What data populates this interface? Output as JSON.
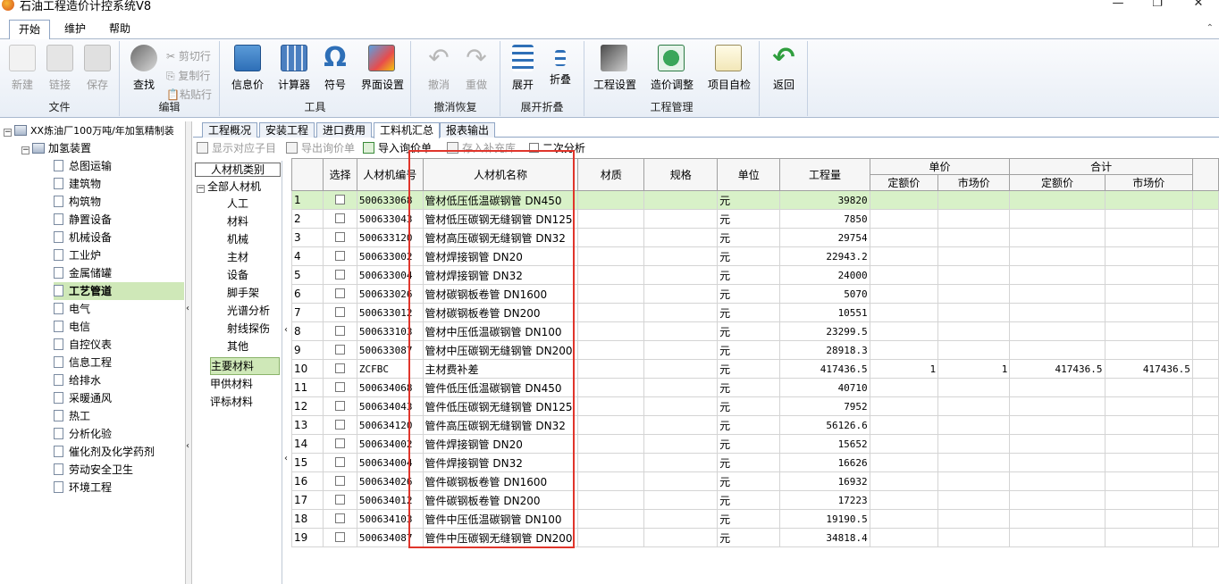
{
  "app": {
    "title": "石油工程造价计控系统V8"
  },
  "menu": {
    "tabs": [
      "开始",
      "维护",
      "帮助"
    ]
  },
  "ribbon": {
    "groups": {
      "file": {
        "title": "文件",
        "new": "新建",
        "link": "链接",
        "save": "保存"
      },
      "edit": {
        "title": "编辑",
        "find": "查找",
        "cut": "剪切行",
        "copy": "复制行",
        "paste": "粘贴行"
      },
      "tools": {
        "title": "工具",
        "info_price": "信息价",
        "calculator": "计算器",
        "symbol": "符号",
        "ui_settings": "界面设置"
      },
      "undo": {
        "title": "撤消恢复",
        "undo": "撤消",
        "redo": "重做"
      },
      "expand": {
        "title": "展开折叠",
        "expand": "展开",
        "collapse": "折叠"
      },
      "project": {
        "title": "工程管理",
        "project_settings": "工程设置",
        "price_adjust": "造价调整",
        "self_check": "项目自检"
      },
      "back": {
        "label": "返回"
      }
    }
  },
  "tree": {
    "root": "XX炼油厂100万吨/年加氢精制装",
    "unit": "加氢装置",
    "items": [
      "总图运输",
      "建筑物",
      "构筑物",
      "静置设备",
      "机械设备",
      "工业炉",
      "金属储罐",
      "工艺管道",
      "电气",
      "电信",
      "自控仪表",
      "信息工程",
      "给排水",
      "采暖通风",
      "热工",
      "分析化验",
      "催化剂及化学药剂",
      "劳动安全卫生",
      "环境工程"
    ],
    "selected": "工艺管道"
  },
  "page_tabs": [
    "工程概况",
    "安装工程",
    "进口费用",
    "工料机汇总",
    "报表输出"
  ],
  "active_tab": "工料机汇总",
  "toolbar": {
    "show_sub": "显示对应子目",
    "export_price": "导出询价单",
    "import_price": "导入询价单",
    "save_lib": "存入补充库",
    "secondary": "二次分析"
  },
  "category": {
    "header": "人材机类别",
    "all": "全部人材机",
    "children": [
      "人工",
      "材料",
      "机械",
      "主材",
      "设备",
      "脚手架",
      "光谱分析",
      "射线探伤",
      "其他"
    ],
    "others": [
      "主要材料",
      "甲供材料",
      "评标材料"
    ],
    "selected": "主要材料"
  },
  "grid": {
    "headers": {
      "select": "选择",
      "code": "人材机编号",
      "name": "人材机名称",
      "material": "材质",
      "spec": "规格",
      "unit": "单位",
      "qty": "工程量",
      "unit_price": "单价",
      "quota_price": "定额价",
      "market_price": "市场价",
      "total": "合计",
      "total_quota": "定额价",
      "total_market": "市场价"
    },
    "rows": [
      {
        "no": "1",
        "code": "500633068",
        "name": "管材低压低温碳钢管 DN450",
        "unit": "元",
        "qty": "39820",
        "qp": "",
        "mp": "",
        "tq": "",
        "tm": ""
      },
      {
        "no": "2",
        "code": "500633043",
        "name": "管材低压碳钢无缝钢管 DN125",
        "unit": "元",
        "qty": "7850",
        "qp": "",
        "mp": "",
        "tq": "",
        "tm": ""
      },
      {
        "no": "3",
        "code": "500633120",
        "name": "管材高压碳钢无缝钢管 DN32",
        "unit": "元",
        "qty": "29754",
        "qp": "",
        "mp": "",
        "tq": "",
        "tm": ""
      },
      {
        "no": "4",
        "code": "500633002",
        "name": "管材焊接钢管 DN20",
        "unit": "元",
        "qty": "22943.2",
        "qp": "",
        "mp": "",
        "tq": "",
        "tm": ""
      },
      {
        "no": "5",
        "code": "500633004",
        "name": "管材焊接钢管 DN32",
        "unit": "元",
        "qty": "24000",
        "qp": "",
        "mp": "",
        "tq": "",
        "tm": ""
      },
      {
        "no": "6",
        "code": "500633026",
        "name": "管材碳钢板卷管 DN1600",
        "unit": "元",
        "qty": "5070",
        "qp": "",
        "mp": "",
        "tq": "",
        "tm": ""
      },
      {
        "no": "7",
        "code": "500633012",
        "name": "管材碳钢板卷管 DN200",
        "unit": "元",
        "qty": "10551",
        "qp": "",
        "mp": "",
        "tq": "",
        "tm": ""
      },
      {
        "no": "8",
        "code": "500633103",
        "name": "管材中压低温碳钢管 DN100",
        "unit": "元",
        "qty": "23299.5",
        "qp": "",
        "mp": "",
        "tq": "",
        "tm": ""
      },
      {
        "no": "9",
        "code": "500633087",
        "name": "管材中压碳钢无缝钢管 DN200",
        "unit": "元",
        "qty": "28918.3",
        "qp": "",
        "mp": "",
        "tq": "",
        "tm": ""
      },
      {
        "no": "10",
        "code": "ZCFBC",
        "name": "主材费补差",
        "unit": "元",
        "qty": "417436.5",
        "qp": "1",
        "mp": "1",
        "tq": "417436.5",
        "tm": "417436.5"
      },
      {
        "no": "11",
        "code": "500634068",
        "name": "管件低压低温碳钢管 DN450",
        "unit": "元",
        "qty": "40710",
        "qp": "",
        "mp": "",
        "tq": "",
        "tm": ""
      },
      {
        "no": "12",
        "code": "500634043",
        "name": "管件低压碳钢无缝钢管 DN125",
        "unit": "元",
        "qty": "7952",
        "qp": "",
        "mp": "",
        "tq": "",
        "tm": ""
      },
      {
        "no": "13",
        "code": "500634120",
        "name": "管件高压碳钢无缝钢管 DN32",
        "unit": "元",
        "qty": "56126.6",
        "qp": "",
        "mp": "",
        "tq": "",
        "tm": ""
      },
      {
        "no": "14",
        "code": "500634002",
        "name": "管件焊接钢管 DN20",
        "unit": "元",
        "qty": "15652",
        "qp": "",
        "mp": "",
        "tq": "",
        "tm": ""
      },
      {
        "no": "15",
        "code": "500634004",
        "name": "管件焊接钢管 DN32",
        "unit": "元",
        "qty": "16626",
        "qp": "",
        "mp": "",
        "tq": "",
        "tm": ""
      },
      {
        "no": "16",
        "code": "500634026",
        "name": "管件碳钢板卷管 DN1600",
        "unit": "元",
        "qty": "16932",
        "qp": "",
        "mp": "",
        "tq": "",
        "tm": ""
      },
      {
        "no": "17",
        "code": "500634012",
        "name": "管件碳钢板卷管 DN200",
        "unit": "元",
        "qty": "17223",
        "qp": "",
        "mp": "",
        "tq": "",
        "tm": ""
      },
      {
        "no": "18",
        "code": "500634103",
        "name": "管件中压低温碳钢管 DN100",
        "unit": "元",
        "qty": "19190.5",
        "qp": "",
        "mp": "",
        "tq": "",
        "tm": ""
      },
      {
        "no": "19",
        "code": "500634087",
        "name": "管件中压碳钢无缝钢管 DN200",
        "unit": "元",
        "qty": "34818.4",
        "qp": "",
        "mp": "",
        "tq": "",
        "tm": ""
      }
    ]
  },
  "colors": {
    "accent": "#2e6fb7",
    "selection": "#cfe8b8",
    "row_highlight": "#d8f1c8",
    "annotation": "#e0352b"
  }
}
